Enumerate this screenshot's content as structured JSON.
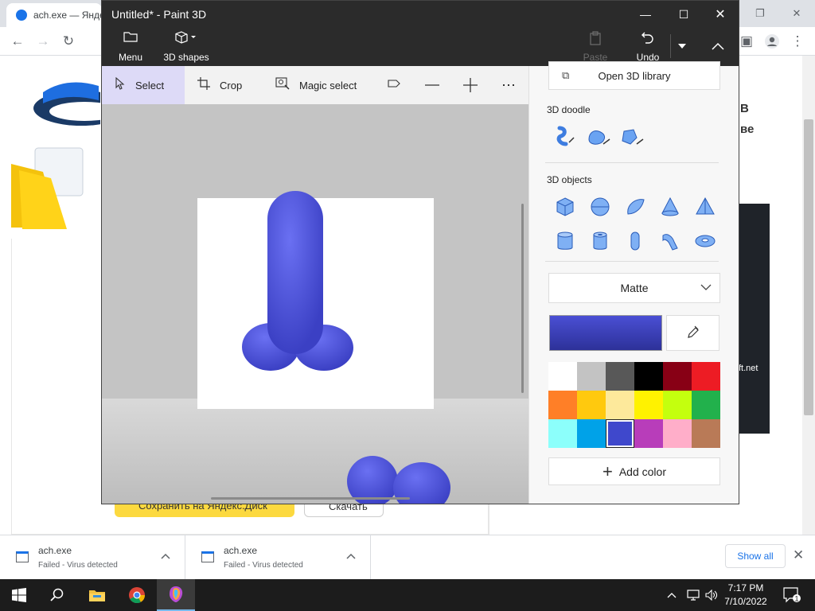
{
  "browser": {
    "tab_title": "ach.exe — Яндекс",
    "controls": {
      "minimize": "—",
      "maximize": "❐",
      "close": "✕"
    },
    "page": {
      "yellow_button": "Сохранить на Яндекс.Диск",
      "gray_button": "Скачать",
      "right_text_1": "В",
      "right_text_2": "ве",
      "ad_text": "ft.net"
    }
  },
  "paint3d": {
    "title": "Untitled* - Paint 3D",
    "toolbar": {
      "menu": "Menu",
      "shapes": "3D shapes",
      "paste": "Paste",
      "undo": "Undo"
    },
    "tools": {
      "select": "Select",
      "crop": "Crop",
      "magic_select": "Magic select"
    },
    "panel": {
      "library": "Open 3D library",
      "doodle_title": "3D doodle",
      "objects_title": "3D objects",
      "material": "Matte",
      "add_color": "Add color",
      "current_color": "#4a4fd4",
      "palette": [
        "#ffffff",
        "#c3c3c3",
        "#585858",
        "#000000",
        "#880015",
        "#ed1c24",
        "#ff7f27",
        "#ffc90e",
        "#fde99b",
        "#fff200",
        "#c4ff0e",
        "#22b14c",
        "#8cfffb",
        "#00a2e8",
        "#3f48cc",
        "#b83dba",
        "#ffaec9",
        "#b97a57"
      ],
      "selected_swatch": 14
    }
  },
  "downloads": {
    "items": [
      {
        "name": "ach.exe",
        "status": "Failed - Virus detected"
      },
      {
        "name": "ach.exe",
        "status": "Failed - Virus detected"
      }
    ],
    "show_all": "Show all"
  },
  "taskbar": {
    "time": "7:17 PM",
    "date": "7/10/2022",
    "notification_count": "1"
  }
}
